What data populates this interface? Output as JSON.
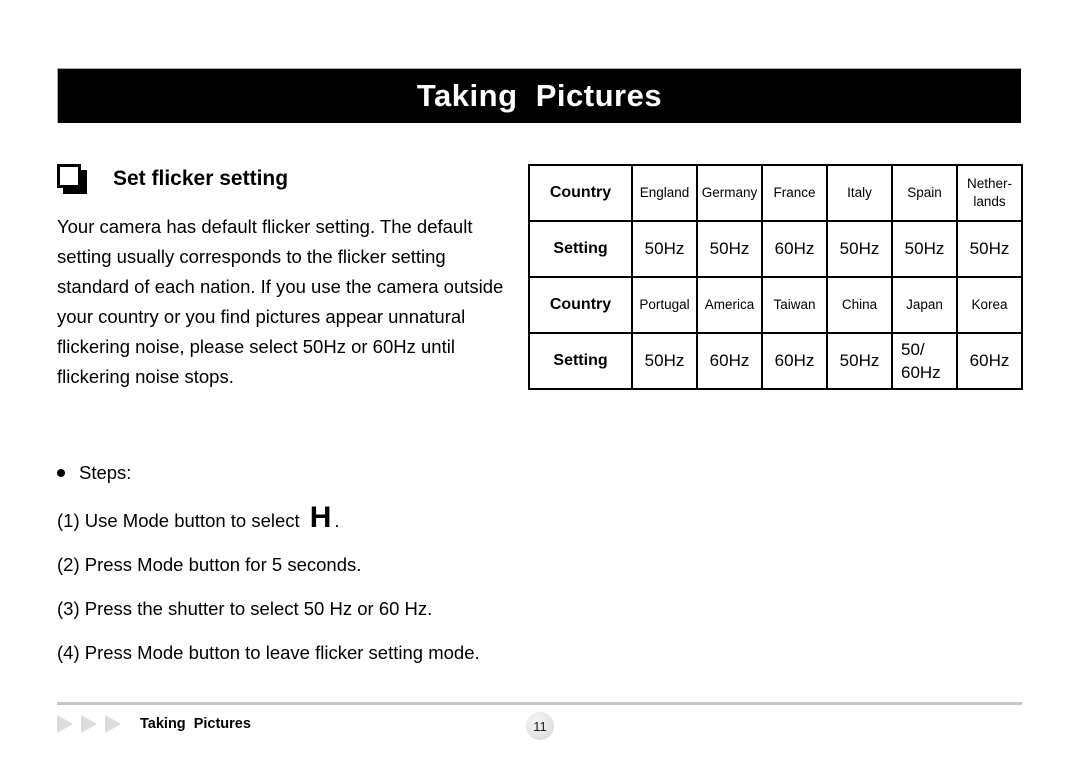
{
  "header": {
    "title": "Taking  Pictures"
  },
  "section": {
    "bullet_icon": "square-bullet-icon",
    "title": "Set flicker setting",
    "body": "Your camera has default flicker setting. The default setting usually corresponds to the flicker setting standard of each nation. If you use the camera outside your country or you find pictures appear unnatural flickering noise, please select 50Hz or 60Hz until flickering noise stops."
  },
  "table": {
    "row_labels": {
      "country": "Country",
      "setting": "Setting"
    },
    "rows": [
      {
        "label": "Country",
        "cells": [
          "England",
          "Germany",
          "France",
          "Italy",
          "Spain",
          "Nether-\nlands"
        ]
      },
      {
        "label": "Setting",
        "cells": [
          "50Hz",
          "50Hz",
          "60Hz",
          "50Hz",
          "50Hz",
          "50Hz"
        ]
      },
      {
        "label": "Country",
        "cells": [
          "Portugal",
          "America",
          "Taiwan",
          "China",
          "Japan",
          "Korea"
        ]
      },
      {
        "label": "Setting",
        "cells": [
          "50Hz",
          "60Hz",
          "60Hz",
          "50Hz",
          "50/\n60Hz",
          "60Hz"
        ]
      }
    ]
  },
  "steps": {
    "heading": "Steps:",
    "items": [
      {
        "prefix": "(1) Use Mode button to select",
        "glyph": "H",
        "suffix": "."
      },
      {
        "prefix": "(2) Press Mode button for 5 seconds.",
        "glyph": "",
        "suffix": ""
      },
      {
        "prefix": "(3) Press the shutter to select 50 Hz or 60 Hz.",
        "glyph": "",
        "suffix": ""
      },
      {
        "prefix": "(4) Press Mode button to leave flicker setting mode.",
        "glyph": "",
        "suffix": ""
      }
    ]
  },
  "footer": {
    "label": "Taking  Pictures",
    "page_number": "11",
    "arrow_count": 3
  },
  "colors": {
    "banner_bg": "#000000",
    "banner_text": "#ffffff",
    "rule": "#c6c6c6",
    "arrow": "#dcdcdc",
    "table_border": "#000000"
  }
}
